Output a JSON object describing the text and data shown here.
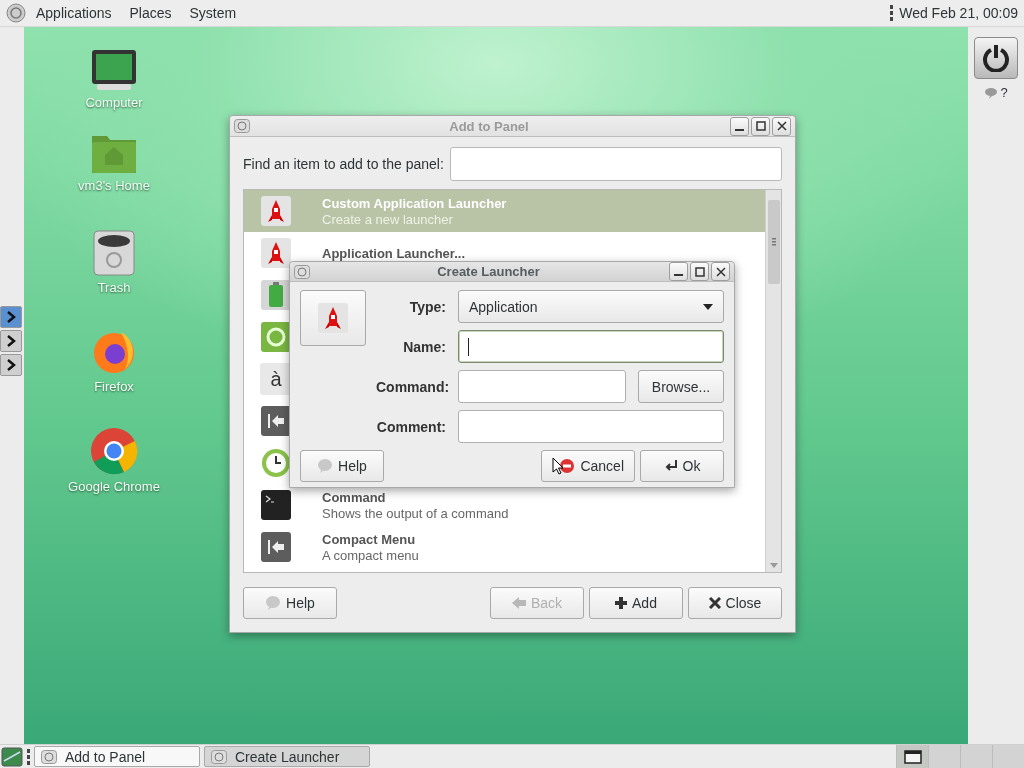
{
  "top_panel": {
    "menus": [
      "Applications",
      "Places",
      "System"
    ],
    "clock": "Wed Feb 21, 00:09"
  },
  "desktop_icons": [
    {
      "kind": "computer",
      "label": "Computer"
    },
    {
      "kind": "home",
      "label": "vm3's Home"
    },
    {
      "kind": "trash",
      "label": "Trash"
    },
    {
      "kind": "firefox",
      "label": "Firefox"
    },
    {
      "kind": "chrome",
      "label": "Google Chrome"
    }
  ],
  "side_launchers": [
    {
      "selected": true
    },
    {
      "selected": false
    },
    {
      "selected": false
    }
  ],
  "right_panel": {
    "weather": "?"
  },
  "add_to_panel": {
    "title": "Add to Panel",
    "active": false,
    "find_label": "Find an item to add to the panel:",
    "items": [
      {
        "kind": "rocket",
        "title": "Custom Application Launcher",
        "description": "Create a new launcher",
        "selected": true
      },
      {
        "kind": "rocket",
        "title": "Application Launcher...",
        "selected": false
      },
      {
        "kind": "battery",
        "selected": false
      },
      {
        "kind": "ring",
        "selected": false
      },
      {
        "kind": "glyph",
        "glyph": "à",
        "selected": false
      },
      {
        "kind": "compact",
        "selected": false
      },
      {
        "kind": "clock",
        "selected": false
      },
      {
        "kind": "terminal",
        "title": "Command",
        "description": "Shows the output of a command",
        "selected": false
      },
      {
        "kind": "compact",
        "title": "Compact Menu",
        "description": "A compact menu",
        "selected": false
      }
    ],
    "buttons": [
      {
        "kind": "help",
        "label": "Help",
        "disabled": false
      },
      {
        "kind": "back",
        "label": "Back",
        "disabled": true
      },
      {
        "kind": "add",
        "label": "Add",
        "disabled": false
      },
      {
        "kind": "close",
        "label": "Close",
        "disabled": false
      }
    ]
  },
  "create_launcher": {
    "title": "Create Launcher",
    "active": true,
    "fields": [
      {
        "kind": "dropdown",
        "label": "Type:",
        "value": "Application"
      },
      {
        "kind": "text",
        "label": "Name:",
        "focused": true
      },
      {
        "kind": "browse",
        "label": "Command:",
        "button": "Browse...",
        "focused": false
      },
      {
        "kind": "text",
        "label": "Comment:",
        "focused": false
      }
    ],
    "buttons": [
      {
        "kind": "help",
        "label": "Help"
      },
      {
        "kind": "cancel",
        "label": "Cancel"
      },
      {
        "kind": "ok",
        "label": "Ok"
      }
    ]
  },
  "taskbar": {
    "tasks": [
      {
        "label": "Add to Panel",
        "selected": false
      },
      {
        "label": "Create Launcher",
        "selected": true
      }
    ],
    "workspaces": [
      {
        "selected": true
      },
      {
        "selected": false
      },
      {
        "selected": false
      },
      {
        "selected": false
      }
    ]
  }
}
